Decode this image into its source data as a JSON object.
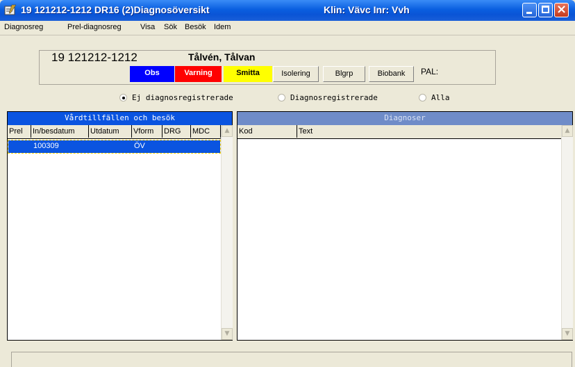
{
  "window": {
    "title": "19 121212-1212   DR16 (2)Diagnosöversikt",
    "klinik": "Klin: Vävc  Inr: Vvh"
  },
  "menu": [
    "Diagnosreg",
    "Prel-diagnosreg",
    "Visa",
    "Sök",
    "Besök",
    "Idem"
  ],
  "patient": {
    "personnummer": "19 121212-1212",
    "name": "Tålvén, Tålvan",
    "tags": {
      "obs": "Obs",
      "varning": "Varning",
      "smitta": "Smitta"
    },
    "buttons": {
      "isolering": "Isolering",
      "blgrp": "Blgrp",
      "biobank": "Biobank"
    },
    "pal": "PAL:"
  },
  "filter": {
    "options": [
      "Ej diagnosregistrerade",
      "Diagnosregistrerade",
      "Alla"
    ],
    "selected": "Ej diagnosregistrerade"
  },
  "visits": {
    "title": "Vårdtillfällen och besök",
    "columns": [
      "Prel",
      "In/besdatum",
      "Utdatum",
      "Vform",
      "DRG",
      "MDC"
    ],
    "rows": [
      {
        "prel": "",
        "in": "100309",
        "ut": "",
        "vform": "ÖV",
        "drg": "",
        "mdc": ""
      }
    ]
  },
  "diagnoses": {
    "title": "Diagnoser",
    "columns": [
      "Kod",
      "Text"
    ]
  },
  "colors": {
    "titlebar": "#0a54e0",
    "obs": "#0000ff",
    "varning": "#ff0000",
    "smitta": "#ffff00",
    "selection": "#0a54e0"
  }
}
